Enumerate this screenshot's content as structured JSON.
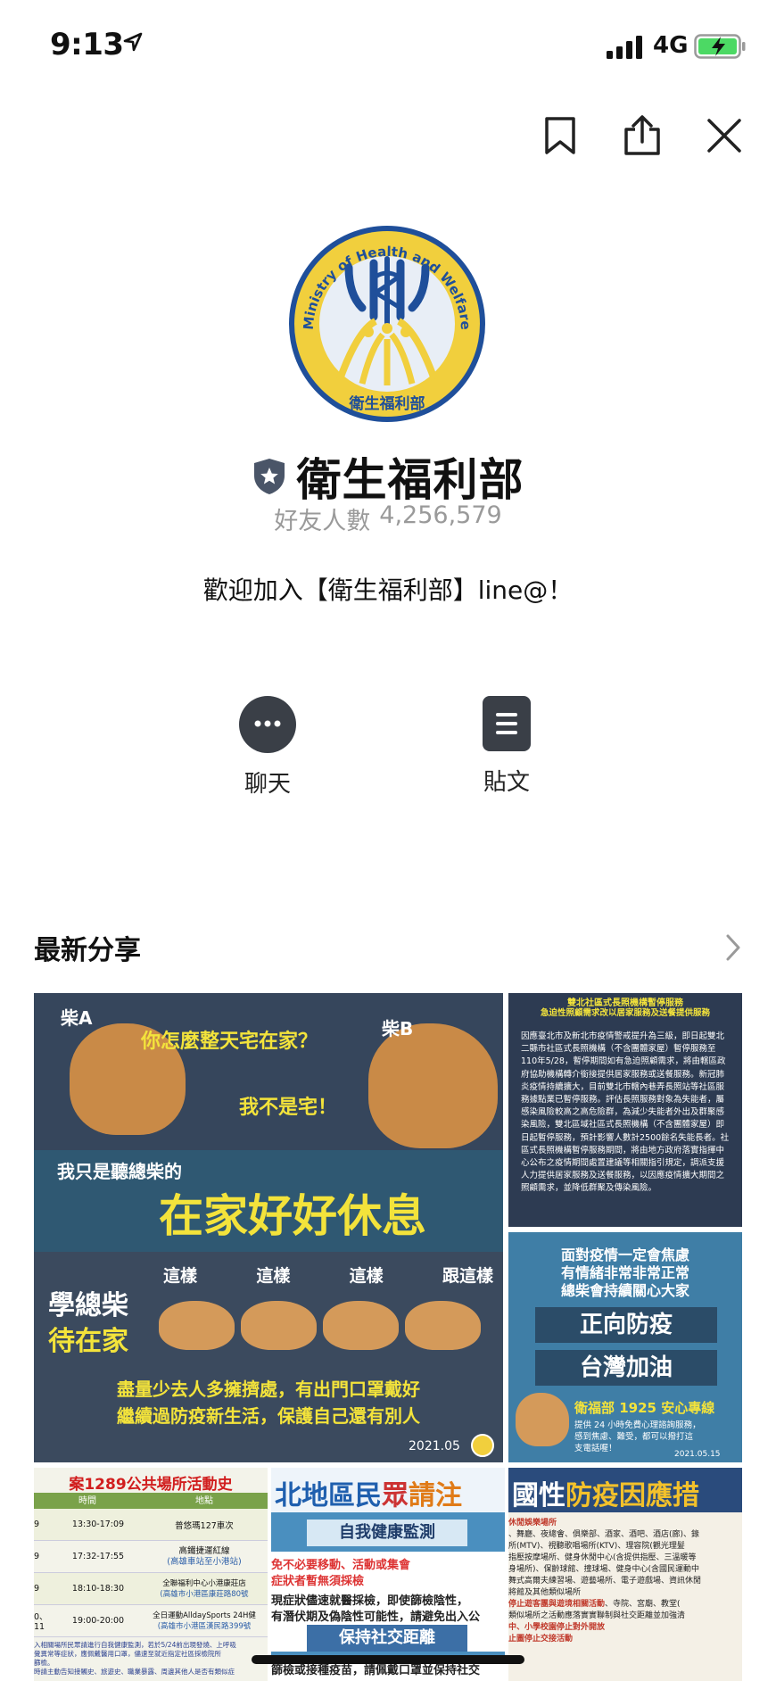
{
  "status_bar": {
    "time": "9:13",
    "network": "4G"
  },
  "profile": {
    "name": "衛生福利部",
    "friends_label": "好友人數",
    "friends_count": "4,256,579",
    "welcome": "歡迎加入【衛生福利部】line@！",
    "logo_text_en": "Ministry of Health and Welfare",
    "logo_text_zh": "衛生福利部"
  },
  "actions": [
    {
      "label": "聊天",
      "icon": "chat-bubble-icon"
    },
    {
      "label": "貼文",
      "icon": "post-list-icon"
    }
  ],
  "section": {
    "title": "最新分享"
  },
  "tile1": {
    "dog_a": "柴A",
    "dog_b": "柴B",
    "q": "你怎麼整天宅在家？",
    "a": "我不是宅！",
    "sub": "我只是聽總柴的",
    "headline": "在家好好休息",
    "left1": "學總柴",
    "left2": "待在家",
    "steps": [
      "這樣",
      "這樣",
      "這樣",
      "跟這樣"
    ],
    "bottom1": "盡量少去人多擁擠處，有出門口罩戴好",
    "bottom2": "繼續過防疫新生活，保護自己還有別人",
    "date": "2021.05"
  },
  "tile2": {
    "title1": "雙北社區式長照機構暫停服務",
    "title2": "急迫性照顧需求改以居家服務及送餐提供服務",
    "body": "因應臺北市及新北市疫情警戒提升為三級，即日起雙北二縣市社區式長照機構（不含團體家屋）暫停服務至110年5/28，暫停期間如有急迫照顧需求，將由轄區政府協助機構轉介銜接提供居家服務或送餐服務。新冠肺炎疫情持續擴大，目前雙北市轄內巷弄長照站等社區服務據點業已暫停服務。評估長照服務對象為失能者，屬感染風險較高之高危險群，為減少失能者外出及群聚感染風險，雙北區域社區式長照機構（不含團體家屋）即日起暫停服務，預計影響人數計2500餘名失能長者。社區式長照機構暫停服務期間，將由地方政府落實指揮中心公布之疫情期間處置建議等相關指引規定，調派支援人力提供居家服務及送餐服務，以因應疫情擴大期間之照顧需求，並降低群聚及傳染風險。"
  },
  "tile3": {
    "l1": "面對疫情一定會焦慮",
    "l2": "有情緒非常非常正常",
    "l3": "總柴會持續關心大家",
    "b1": "正向防疫",
    "b2": "台灣加油",
    "hotline": "衛福部 1925 安心專線",
    "desc1": "提供 24 小時免費心理諮詢服務，",
    "desc2": "感到焦慮、難受，都可以撥打這",
    "desc3": "支電話喔！",
    "date": "2021.05.15"
  },
  "tile4": {
    "title": "案1289公共場所活動史",
    "h1": "時間",
    "h2": "地點",
    "rows": [
      {
        "d": "9",
        "t": "13:30-17:09",
        "p": "普悠瑪127車次",
        "s": ""
      },
      {
        "d": "9",
        "t": "17:32-17:55",
        "p": "高鐵捷運紅線",
        "s": "(高雄車站至小港站)"
      },
      {
        "d": "9",
        "t": "18:10-18:30",
        "p": "全聯福利中心小港康莊店",
        "s": "(高雄市小港區康莊路80號"
      },
      {
        "d": "0、11",
        "t": "19:00-20:00",
        "p": "全日運動AlldaySports 24H健",
        "s": "(高雄市小港區漢民路399號"
      }
    ],
    "foot1": "入相關場所民眾請進行自我健康監測，若於5/24前出現發燒、上呼吸",
    "foot2": "覺異常等症狀，應佩戴醫用口罩，儘速至就近指定社區採檢院所",
    "foot3": "篩檢。",
    "foot4": "時請主動告知接觸史、旅遊史、職業暴露、周邊其他人是否有類似症"
  },
  "tile5": {
    "title_a": "北地區民",
    "title_b": "眾",
    "title_c": "請注",
    "box1": "自我健康監測",
    "line1": "免不必要移動、活動或集會",
    "line2": "症狀者暫無須採檢",
    "line3": "現症狀儘速就醫採檢，即使篩檢陰性，",
    "line4": "有潛伏期及偽陰性可能性，請避免出入公",
    "box2": "保持社交距離",
    "line5": "篩檢或接種疫苗，請佩戴口罩並保持社交"
  },
  "tile6": {
    "title_a": "國性",
    "title_b": "防疫因應措",
    "h1": "休閒娛樂場所",
    "p1": "、舞廳、夜總會、俱樂部、酒家、酒吧、酒店(廊)、錄",
    "p2": "所(MTV)、視聽歌唱場所(KTV)、理容院(觀光理髮",
    "p3": "指壓按摩場所、健身休閒中心(含提供指壓、三溫暖等",
    "p4": "身場所)、保齡球館、撞球場、健身中心(含國民運動中",
    "p5": "舞式高爾夫練習場、遊藝場所、電子遊戲場、資訊休閒",
    "p6": "將館及其他類似場所",
    "h2": "停止遊客團與遊境相關活動",
    "p7": "、寺院、宮廟、教堂(",
    "p8": "類似場所之活動應落實實聯制與社交距離並加強清",
    "h3": "中、小學校園停止對外開放",
    "h4": "止圖停止交接活動"
  },
  "colors": {
    "accent_dark": "#3a3f47",
    "badge": "#4a5568",
    "gray_text": "#9a9a9a"
  }
}
